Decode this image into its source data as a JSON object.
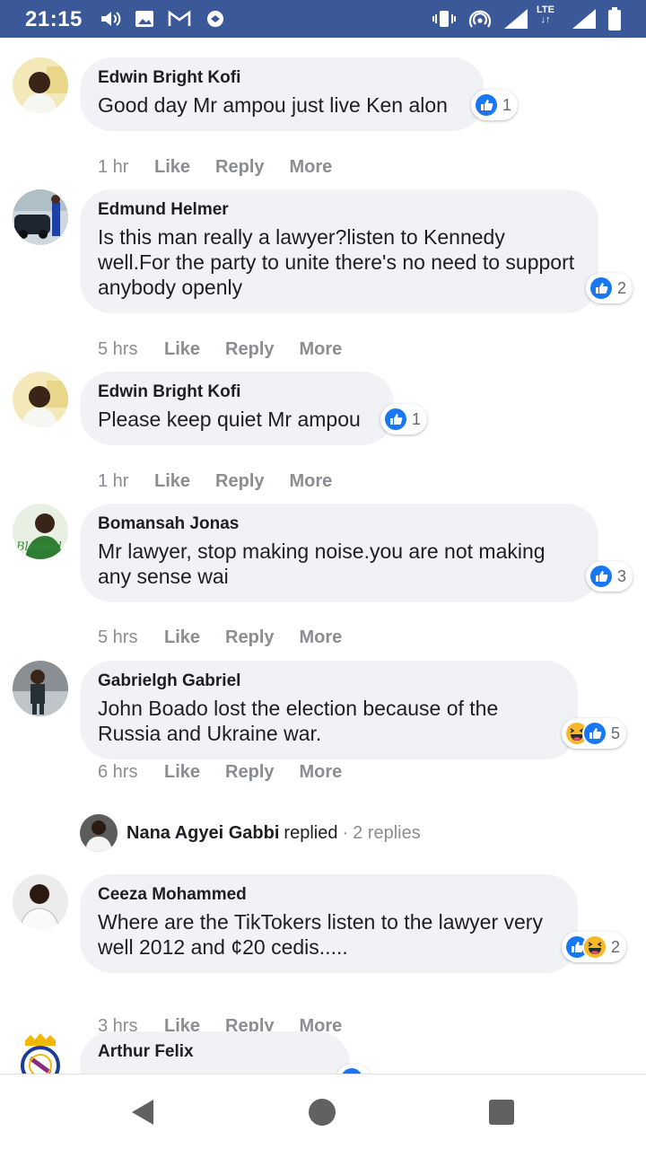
{
  "status_bar": {
    "time": "21:15",
    "network_label": "LTE",
    "icons": [
      "volume-icon",
      "image-icon",
      "gmail-icon",
      "data-saver-icon",
      "vibrate-icon",
      "hotspot-icon",
      "signal-icon",
      "signal-icon",
      "battery-icon"
    ]
  },
  "comments": [
    {
      "author": "Edwin Bright Kofi",
      "text": "Good day Mr ampou just live Ken alon",
      "reactions": [
        "like"
      ],
      "reaction_count": "1",
      "time": "1 hr",
      "like": "Like",
      "reply": "Reply",
      "more": "More"
    },
    {
      "author": "Edmund Helmer",
      "text": "Is this man really a lawyer?listen to Kennedy well.For the party to unite there's no need to support anybody openly",
      "reactions": [
        "like"
      ],
      "reaction_count": "2",
      "time": "5 hrs",
      "like": "Like",
      "reply": "Reply",
      "more": "More"
    },
    {
      "author": "Edwin Bright Kofi",
      "text": "Please keep quiet Mr ampou",
      "reactions": [
        "like"
      ],
      "reaction_count": "1",
      "time": "1 hr",
      "like": "Like",
      "reply": "Reply",
      "more": "More"
    },
    {
      "author": "Bomansah Jonas",
      "text": "Mr lawyer, stop making noise.you are not making any sense wai",
      "reactions": [
        "like"
      ],
      "reaction_count": "3",
      "time": "5 hrs",
      "like": "Like",
      "reply": "Reply",
      "more": "More"
    },
    {
      "author": "Gabrielgh Gabriel",
      "text": "John Boado lost the election because of the Russia and Ukraine war.",
      "reactions": [
        "haha",
        "like"
      ],
      "reaction_count": "5",
      "time": "6 hrs",
      "like": "Like",
      "reply": "Reply",
      "more": "More"
    },
    {
      "author": "Ceeza Mohammed",
      "text": "Where are the TikTokers listen to the lawyer very well 2012 and ¢20 cedis.....",
      "reactions": [
        "like",
        "haha"
      ],
      "reaction_count": "2",
      "time": "3 hrs",
      "like": "Like",
      "reply": "Reply",
      "more": "More"
    },
    {
      "author": "Arthur Felix",
      "text": "",
      "reactions": [
        "like"
      ],
      "reaction_count": "",
      "time": "",
      "like": "",
      "reply": "",
      "more": ""
    }
  ],
  "replies": {
    "name": "Nana Agyei Gabbi",
    "verb": "replied",
    "separator": "·",
    "count": "2 replies"
  },
  "colors": {
    "status_bar": "#3b5998",
    "bubble": "#f0f2f5",
    "like_blue": "#1877f2",
    "haha_yellow": "#f7b928",
    "muted_text": "#8a8d91"
  },
  "nav": {
    "icons": [
      "back-icon",
      "home-icon",
      "recents-icon"
    ]
  }
}
